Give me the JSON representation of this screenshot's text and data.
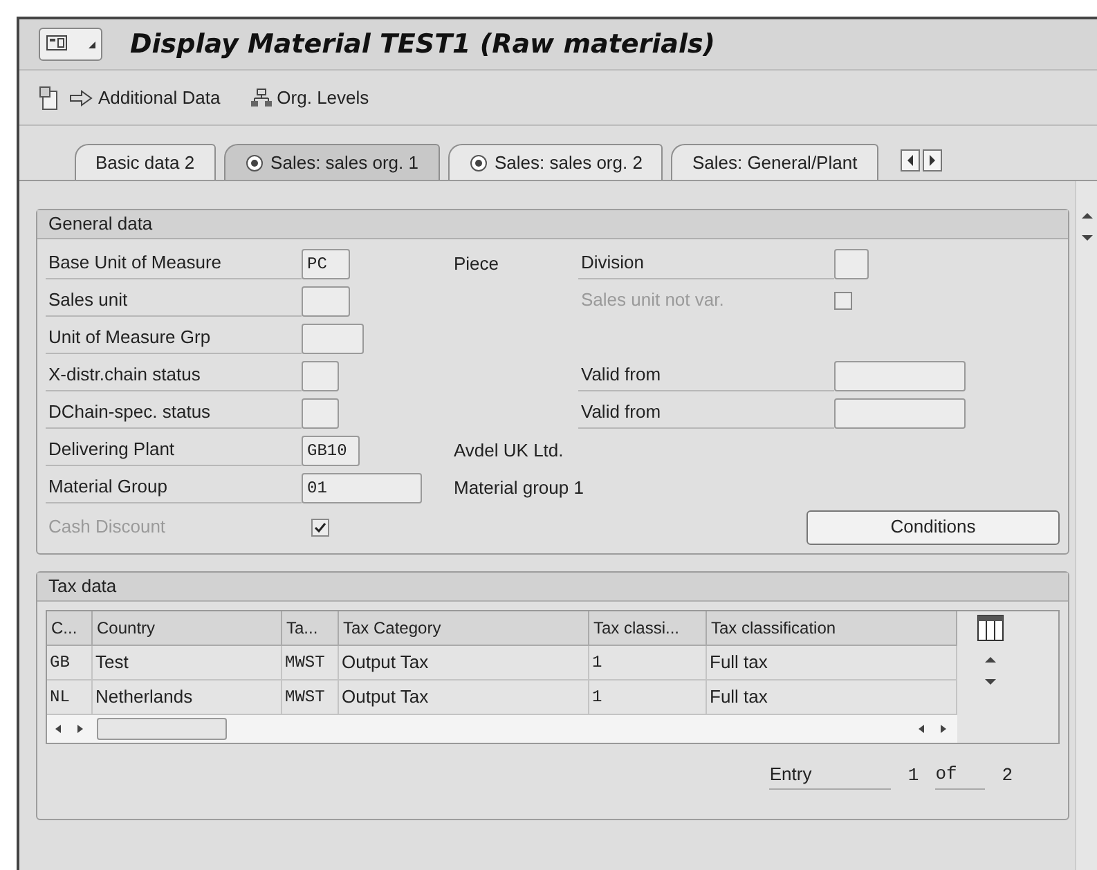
{
  "window": {
    "title": "Display Material TEST1 (Raw materials)"
  },
  "toolbar": [
    {
      "label": "Additional Data",
      "kind": "arrow"
    },
    {
      "label": "Org. Levels",
      "kind": "hierarchy"
    }
  ],
  "tabs": [
    {
      "label": "Basic data 2",
      "kind": "plain",
      "selected": false
    },
    {
      "label": "Sales: sales org. 1",
      "kind": "org",
      "selected": true
    },
    {
      "label": "Sales: sales org. 2",
      "kind": "org",
      "selected": false
    },
    {
      "label": "Sales: General/Plant",
      "kind": "plain",
      "selected": false
    }
  ],
  "general_data": {
    "title": "General data",
    "rows": [
      {
        "label": "Base Unit of Measure",
        "value": "PC",
        "description": "Piece",
        "right": {
          "label": "Division",
          "kind": "field"
        }
      },
      {
        "label": "Sales unit",
        "right": {
          "label": "Sales unit not var.",
          "kind": "checkbox",
          "checked": false,
          "disabled": true
        }
      },
      {
        "label": "Unit of Measure Grp"
      },
      {
        "label": "X-distr.chain status",
        "right": {
          "label": "Valid from",
          "kind": "field"
        }
      },
      {
        "label": "DChain-spec. status",
        "right": {
          "label": "Valid from",
          "kind": "field"
        }
      },
      {
        "label": "Delivering Plant",
        "value": "GB10",
        "description": "Avdel UK Ltd."
      },
      {
        "label": "Material Group",
        "value": "01",
        "description": "Material group 1"
      }
    ],
    "cash_discount": {
      "label": "Cash Discount",
      "checked": true,
      "disabled": true
    },
    "conditions_button": "Conditions"
  },
  "tax_data": {
    "title": "Tax data",
    "columns": [
      "C...",
      "Country",
      "Ta...",
      "Tax Category",
      "Tax classi...",
      "Tax classification"
    ],
    "rows": [
      [
        "GB",
        "Test",
        "MWST",
        "Output Tax",
        "1",
        "Full tax"
      ],
      [
        "NL",
        "Netherlands",
        "MWST",
        "Output Tax",
        "1",
        "Full tax"
      ]
    ],
    "entry": {
      "label": "Entry",
      "current": "1",
      "of": "of",
      "total": "2"
    }
  }
}
